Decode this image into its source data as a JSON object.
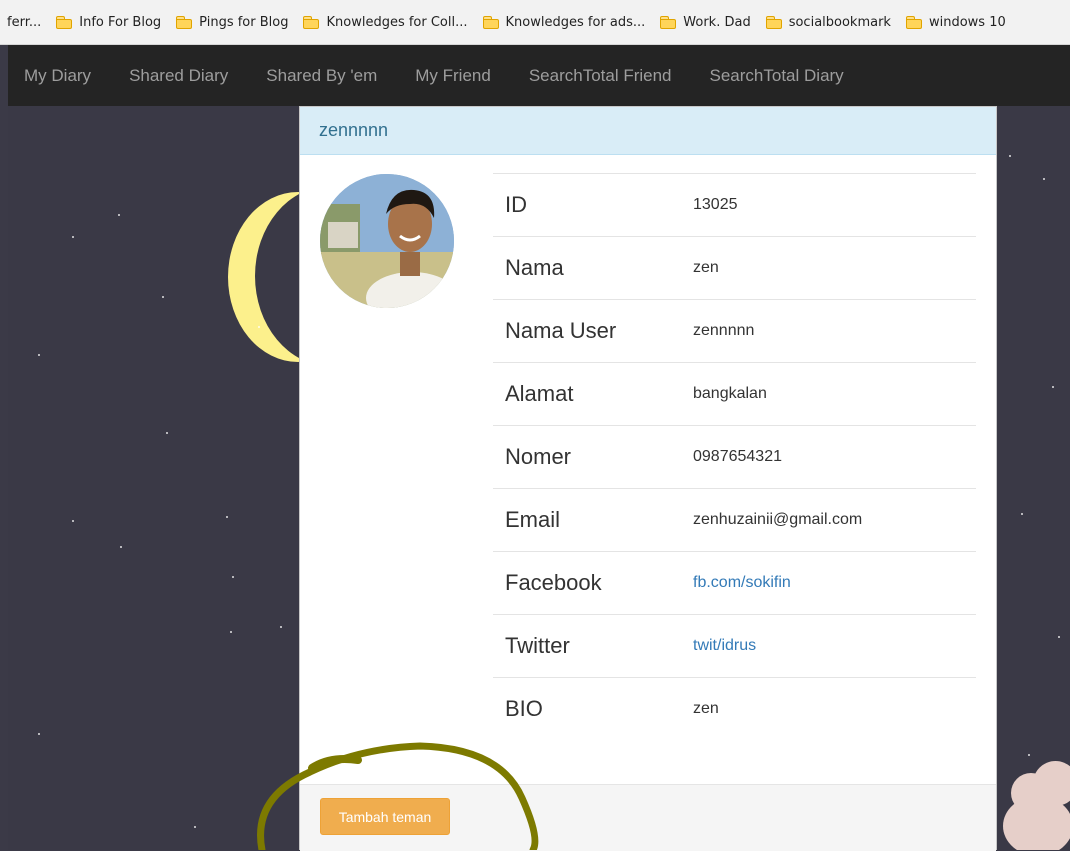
{
  "bookmarks": [
    {
      "label": "ferr...",
      "folder": false
    },
    {
      "label": "Info For Blog",
      "folder": true
    },
    {
      "label": "Pings for Blog",
      "folder": true
    },
    {
      "label": "Knowledges for Coll...",
      "folder": true
    },
    {
      "label": "Knowledges for ads...",
      "folder": true
    },
    {
      "label": "Work. Dad",
      "folder": true
    },
    {
      "label": "socialbookmark",
      "folder": true
    },
    {
      "label": "windows 10",
      "folder": true
    }
  ],
  "nav": {
    "items": [
      "My Diary",
      "Shared Diary",
      "Shared By 'em",
      "My Friend",
      "SearchTotal Friend",
      "SearchTotal Diary"
    ]
  },
  "modal": {
    "title": "zennnnn",
    "rows": [
      {
        "label": "ID",
        "value": "13025",
        "link": false
      },
      {
        "label": "Nama",
        "value": "zen",
        "link": false
      },
      {
        "label": "Nama User",
        "value": "zennnnn",
        "link": false
      },
      {
        "label": "Alamat",
        "value": "bangkalan",
        "link": false
      },
      {
        "label": "Nomer",
        "value": "0987654321",
        "link": false
      },
      {
        "label": "Email",
        "value": "zenhuzainii@gmail.com",
        "link": false
      },
      {
        "label": "Facebook",
        "value": "fb.com/sokifin",
        "link": true
      },
      {
        "label": "Twitter",
        "value": "twit/idrus",
        "link": true
      },
      {
        "label": "BIO",
        "value": "zen",
        "link": false
      }
    ],
    "add_friend_button": "Tambah teman"
  },
  "colors": {
    "modal_header_bg": "#d9edf7",
    "modal_header_text": "#31708f",
    "button_warning": "#f0ad4e",
    "link": "#337ab7",
    "navbar": "#242424",
    "annotation": "#7d7a00"
  },
  "icons": [
    "folder-icon",
    "profile-photo"
  ]
}
